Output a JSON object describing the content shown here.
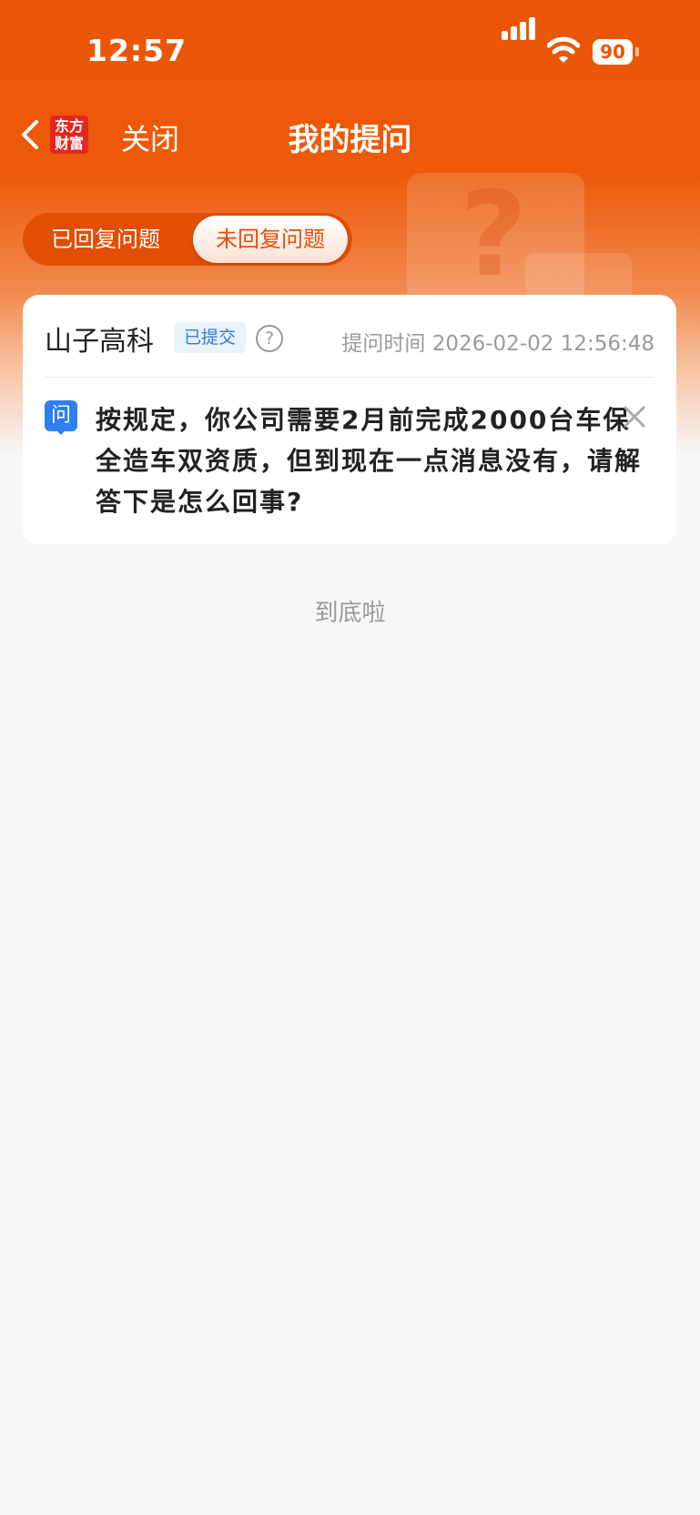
{
  "status_bar": {
    "time": "12:57",
    "battery": "90"
  },
  "nav": {
    "logo_line1": "东方",
    "logo_line2": "财富",
    "close_label": "关闭",
    "title": "我的提问"
  },
  "tabs": [
    {
      "label": "已回复问题",
      "selected": false
    },
    {
      "label": "未回复问题",
      "selected": true
    }
  ],
  "question_card": {
    "company": "山子高科",
    "status_badge": "已提交",
    "ask_time_label": "提问时间",
    "ask_time": "2026-02-02 12:56:48",
    "question_icon": "问",
    "question_text": "按规定，你公司需要2月前完成2000台车保全造车双资质，但到现在一点消息没有，请解答下是怎么回事?"
  },
  "footer": {
    "end_text": "到底啦"
  },
  "colors": {
    "accent": "#ea5506",
    "badge_blue": "#2f7cd9",
    "question_icon": "#2d7ff2"
  }
}
